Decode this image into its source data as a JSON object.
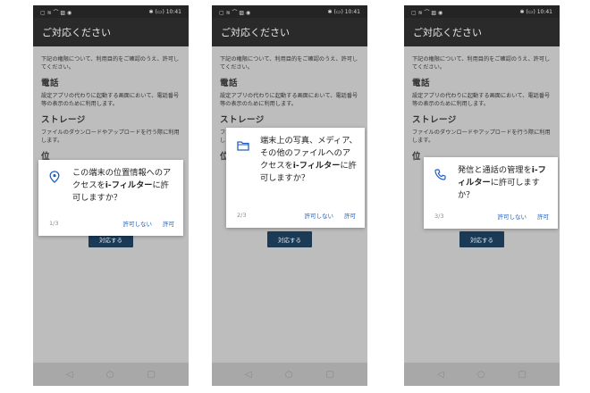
{
  "statusbar": {
    "left_icons": "▢ ≋ ⌒ ▨ ◉",
    "right": "✱ (▭) 10:41"
  },
  "appbar": {
    "title": "ご対応ください"
  },
  "content": {
    "intro": "下記の権限について、利用目的をご確認のうえ、許可してください。",
    "phone_heading": "電話",
    "phone_desc": "設定アプリの代わりに起動する画面において、電話番号等の表示のために利用します。",
    "storage_heading": "ストレージ",
    "storage_desc": "ファイルのダウンロードやアップロードを行う際に利用します。",
    "location_heading_partial": "位",
    "cta_button": "対応する"
  },
  "navbar": {
    "back": "◁",
    "home": "○",
    "recents": "▢"
  },
  "screens": [
    {
      "icon": "location-pin-icon",
      "text_before": "この端末の位置情報へのアクセスを",
      "app_name": "i-フィルター",
      "text_after": "に許可しますか？",
      "step": "1/3",
      "deny": "許可しない",
      "allow": "許可"
    },
    {
      "icon": "folder-icon",
      "text_before": "端末上の写真、メディア、その他のファイルへのアクセスを",
      "app_name": "i-フィルター",
      "text_after": "に許可しますか？",
      "step": "2/3",
      "deny": "許可しない",
      "allow": "許可"
    },
    {
      "icon": "phone-icon",
      "text_before": "発信と通話の管理を",
      "app_name": "i-フィルター",
      "text_after": "に許可しますか？",
      "step": "3/3",
      "deny": "許可しない",
      "allow": "許可"
    }
  ],
  "colors": {
    "accent": "#2060c0",
    "dim_bg": "#bdbdbd",
    "appbar": "#2a2a2a",
    "cta": "#1b3a55"
  }
}
